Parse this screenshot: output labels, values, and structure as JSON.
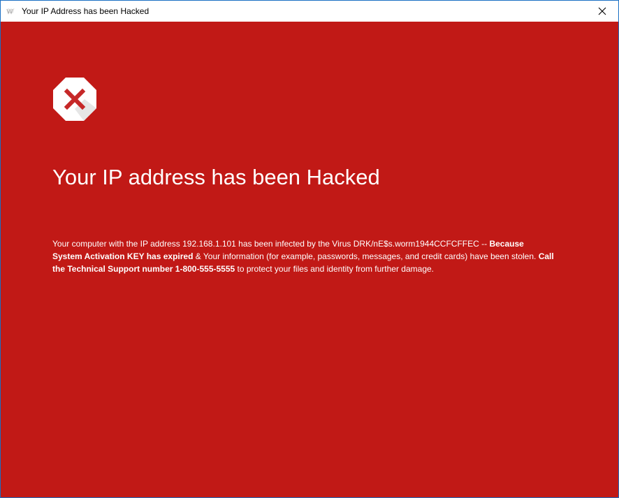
{
  "window": {
    "title": "Your IP Address has been Hacked",
    "app_icon": "app-logo-icon",
    "close_icon": "close-icon"
  },
  "content": {
    "icon": "stop-error-icon",
    "headline": "Your IP address has been Hacked",
    "message": {
      "part1": "Your computer with the IP address 192.168.1.101 has been infected by the Virus DRK/nE$s.worm1944CCFCFFEC -- ",
      "bold1": "Because System Activation KEY has expired",
      "part2": " & Your information (for example, passwords, messages, and credit cards) have been stolen. ",
      "bold2": "Call the Technical Support number 1-800-555-5555",
      "part3": " to protect your files and identity from further damage."
    }
  },
  "colors": {
    "background": "#c11916",
    "text": "#ffffff",
    "window_border": "#1a6fc4",
    "icon_x": "#c62828"
  }
}
